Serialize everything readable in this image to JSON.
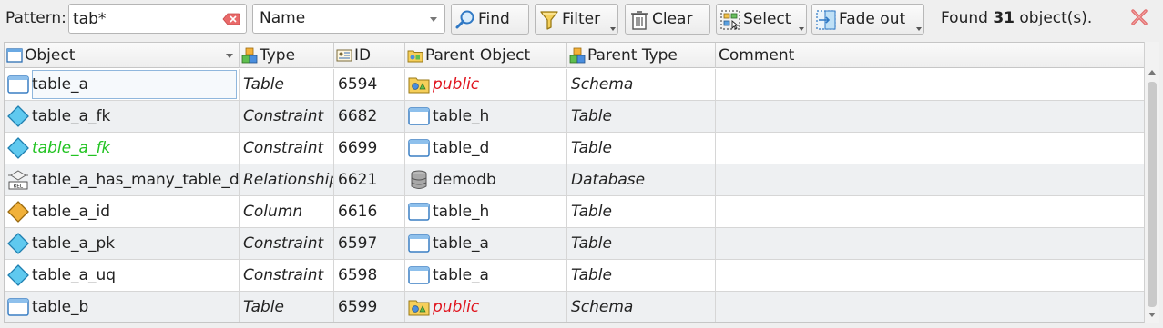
{
  "toolbar": {
    "pattern_label": "Pattern:",
    "pattern_value": "tab*",
    "field_combo_value": "Name",
    "find_label": "Find",
    "filter_label": "Filter",
    "clear_label": "Clear",
    "select_label": "Select",
    "fade_out_label": "Fade out",
    "found_prefix": "Found",
    "found_count": "31",
    "found_suffix": "object(s).",
    "icons": {
      "clear_pattern": "clear-text-icon",
      "find": "magnifier-icon",
      "filter": "funnel-icon",
      "clear": "trash-icon",
      "select": "select-objects-icon",
      "fade_out": "fade-out-icon",
      "close": "close-icon"
    }
  },
  "columns": [
    {
      "label": "Object",
      "icon": "table-icon"
    },
    {
      "label": "Type",
      "icon": "type-blocks-icon"
    },
    {
      "label": "ID",
      "icon": "id-card-icon"
    },
    {
      "label": "Parent Object",
      "icon": "parent-object-icon"
    },
    {
      "label": "Parent Type",
      "icon": "type-blocks-icon"
    },
    {
      "label": "Comment",
      "icon": ""
    }
  ],
  "rows": [
    {
      "object": "table_a",
      "object_icon": "table-icon",
      "type": "Table",
      "id": "6594",
      "parent": "public",
      "parent_icon": "schema-icon",
      "parent_type": "Schema",
      "comment": ""
    },
    {
      "object": "table_a_fk",
      "object_icon": "constraint-diamond-icon",
      "type": "Constraint",
      "id": "6682",
      "parent": "table_h",
      "parent_icon": "table-icon",
      "parent_type": "Table",
      "comment": ""
    },
    {
      "object": "table_a_fk",
      "object_icon": "constraint-diamond-icon",
      "type": "Constraint",
      "id": "6699",
      "parent": "table_d",
      "parent_icon": "table-icon",
      "parent_type": "Table",
      "comment": ""
    },
    {
      "object": "table_a_has_many_table_d",
      "object_icon": "relationship-icon",
      "type": "Relationship",
      "id": "6621",
      "parent": "demodb",
      "parent_icon": "database-icon",
      "parent_type": "Database",
      "comment": ""
    },
    {
      "object": "table_a_id",
      "object_icon": "column-diamond-icon",
      "type": "Column",
      "id": "6616",
      "parent": "table_h",
      "parent_icon": "table-icon",
      "parent_type": "Table",
      "comment": ""
    },
    {
      "object": "table_a_pk",
      "object_icon": "constraint-diamond-icon",
      "type": "Constraint",
      "id": "6597",
      "parent": "table_a",
      "parent_icon": "table-icon",
      "parent_type": "Table",
      "comment": ""
    },
    {
      "object": "table_a_uq",
      "object_icon": "constraint-diamond-icon",
      "type": "Constraint",
      "id": "6598",
      "parent": "table_a",
      "parent_icon": "table-icon",
      "parent_type": "Table",
      "comment": ""
    },
    {
      "object": "table_b",
      "object_icon": "table-icon",
      "type": "Table",
      "id": "6599",
      "parent": "public",
      "parent_icon": "schema-icon",
      "parent_type": "Schema",
      "comment": ""
    }
  ],
  "colors": {
    "schema_parent_text": "#e0141e",
    "highlighted_object_text": "#22c322",
    "close_icon": "#e06b6b",
    "constraint_icon": "#5fc9ef",
    "column_icon": "#f1b13a"
  }
}
